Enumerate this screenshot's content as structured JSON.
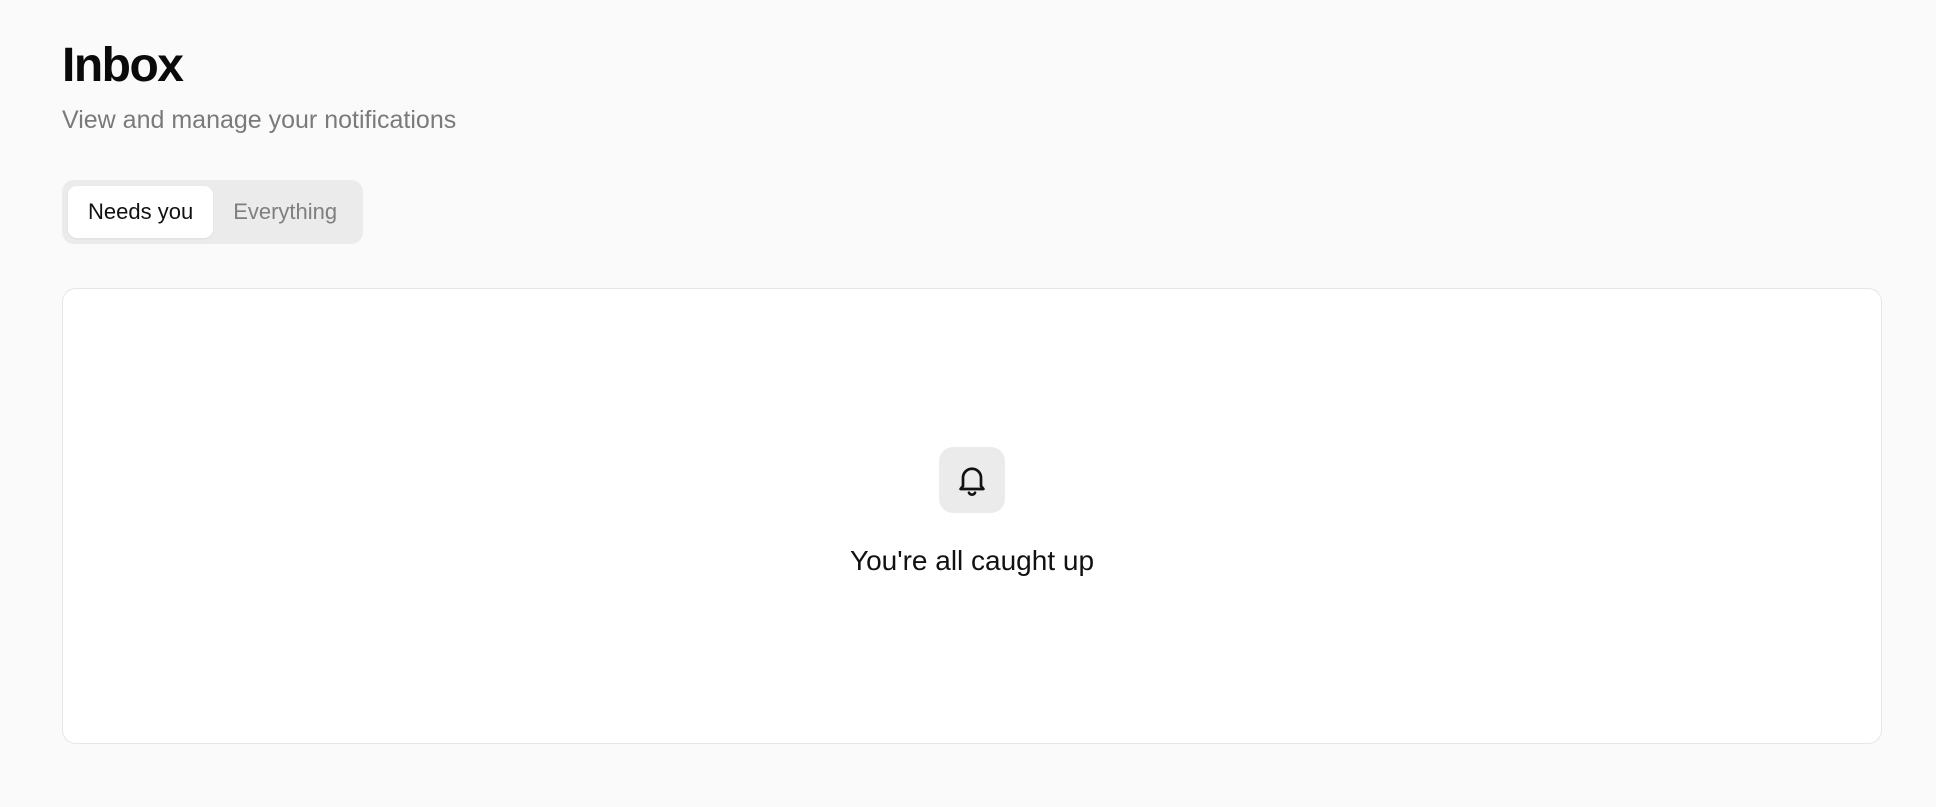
{
  "header": {
    "title": "Inbox",
    "subtitle": "View and manage your notifications"
  },
  "tabs": [
    {
      "label": "Needs you",
      "active": true
    },
    {
      "label": "Everything",
      "active": false
    }
  ],
  "empty_state": {
    "icon": "bell-icon",
    "message": "You're all caught up"
  }
}
